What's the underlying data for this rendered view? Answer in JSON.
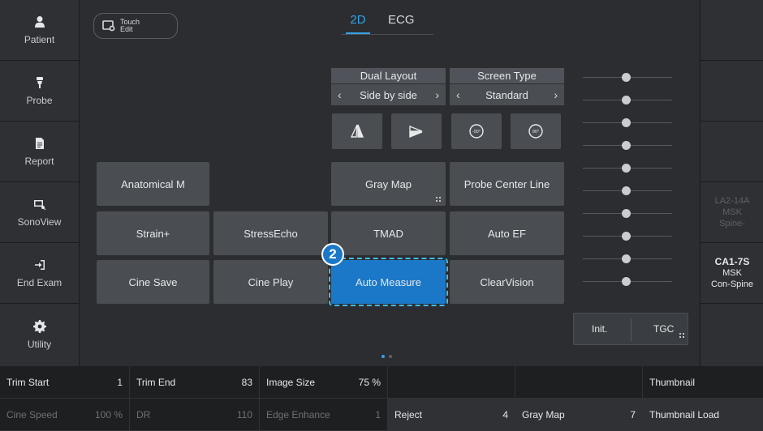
{
  "sidebar": {
    "items": [
      {
        "label": "Patient",
        "icon": "person-icon"
      },
      {
        "label": "Probe",
        "icon": "probe-icon"
      },
      {
        "label": "Report",
        "icon": "document-icon"
      },
      {
        "label": "SonoView",
        "icon": "sonoview-icon"
      },
      {
        "label": "End Exam",
        "icon": "exit-icon"
      },
      {
        "label": "Utility",
        "icon": "gear-icon"
      }
    ]
  },
  "rightbar": {
    "probe1": {
      "line1": "LA2-14A",
      "line2": "MSK",
      "line3": "Spine-"
    },
    "probe2": {
      "line1": "CA1-7S",
      "line2": "MSK",
      "line3": "Con-Spine"
    }
  },
  "touch_edit": {
    "line1": "Touch",
    "line2": "Edit"
  },
  "tabs": [
    {
      "label": "2D",
      "active": true
    },
    {
      "label": "ECG",
      "active": false
    }
  ],
  "dual_layout": {
    "title": "Dual Layout",
    "value": "Side by side"
  },
  "screen_type": {
    "title": "Screen Type",
    "value": "Standard"
  },
  "buttons": {
    "anatomical_m": "Anatomical M",
    "gray_map": "Gray Map",
    "probe_center_line": "Probe Center Line",
    "strain_plus": "Strain+",
    "stress_echo": "StressEcho",
    "tmad": "TMAD",
    "auto_ef": "Auto EF",
    "cine_save": "Cine Save",
    "cine_play": "Cine Play",
    "auto_measure": "Auto Measure",
    "clear_vision": "ClearVision"
  },
  "badge": "2",
  "tgc": {
    "init": "Init.",
    "tgc": "TGC"
  },
  "bottom": {
    "row1": [
      {
        "label": "Trim Start",
        "value": "1"
      },
      {
        "label": "Trim End",
        "value": "83"
      },
      {
        "label": "Image Size",
        "value": "75 %"
      },
      {
        "label": "",
        "value": ""
      },
      {
        "label": "",
        "value": ""
      },
      {
        "label": "Thumbnail",
        "value": ""
      }
    ],
    "row2": [
      {
        "label": "Cine Speed",
        "value": "100 %"
      },
      {
        "label": "DR",
        "value": "110"
      },
      {
        "label": "Edge Enhance",
        "value": "1"
      },
      {
        "label": "Reject",
        "value": "4"
      },
      {
        "label": "Gray Map",
        "value": "7"
      },
      {
        "label": "Thumbnail Load",
        "value": ""
      }
    ]
  },
  "colors": {
    "accent": "#36a2e8",
    "selected": "#1b78c8",
    "selected_outline": "#3bbdf0"
  }
}
